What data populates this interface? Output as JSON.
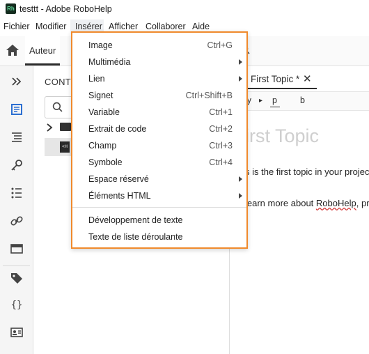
{
  "window": {
    "title": "testtt - Adobe RoboHelp",
    "logo_text": "Rh"
  },
  "menubar": [
    "Fichier",
    "Modifier",
    "Insérer",
    "Afficher",
    "Collaborer",
    "Aide"
  ],
  "toolbar": {
    "tab_label": "Auteur"
  },
  "contents": {
    "title": "CONTE"
  },
  "editor": {
    "tab_label": "First Topic *",
    "tab_close": "✕",
    "breadcrumb": [
      "ly",
      "▸",
      "p",
      "b"
    ],
    "heading": "irst Topic",
    "line1": "s is the first topic in your projec",
    "line2_prefix": "learn more about ",
    "line2_link": "RoboHelp",
    "line2_suffix": ", pr"
  },
  "insert_menu": {
    "items": [
      {
        "label": "Image",
        "shortcut": "Ctrl+G",
        "submenu": false
      },
      {
        "label": "Multimédia",
        "shortcut": "",
        "submenu": true
      },
      {
        "label": "Lien",
        "shortcut": "",
        "submenu": true
      },
      {
        "label": "Signet",
        "shortcut": "Ctrl+Shift+B",
        "submenu": false
      },
      {
        "label": "Variable",
        "shortcut": "Ctrl+1",
        "submenu": false
      },
      {
        "label": "Extrait de code",
        "shortcut": "Ctrl+2",
        "submenu": false
      },
      {
        "label": "Champ",
        "shortcut": "Ctrl+3",
        "submenu": false
      },
      {
        "label": "Symbole",
        "shortcut": "Ctrl+4",
        "submenu": false
      },
      {
        "label": "Espace réservé",
        "shortcut": "",
        "submenu": true
      },
      {
        "label": "Éléments HTML",
        "shortcut": "",
        "submenu": true
      }
    ],
    "items_after_separator": [
      {
        "label": "Développement de texte"
      },
      {
        "label": "Texte de liste déroulante"
      }
    ]
  },
  "colors": {
    "menu_highlight_border": "#f08a2c",
    "app_logo_bg": "#142c1f"
  },
  "icons": [
    "home-icon",
    "expand-icon",
    "document-icon",
    "toc-icon",
    "key-icon",
    "list-icon",
    "link-icon",
    "panel-icon",
    "tag-icon",
    "braces-icon",
    "card-icon",
    "search-icon",
    "folder-icon",
    "html-file-icon"
  ]
}
